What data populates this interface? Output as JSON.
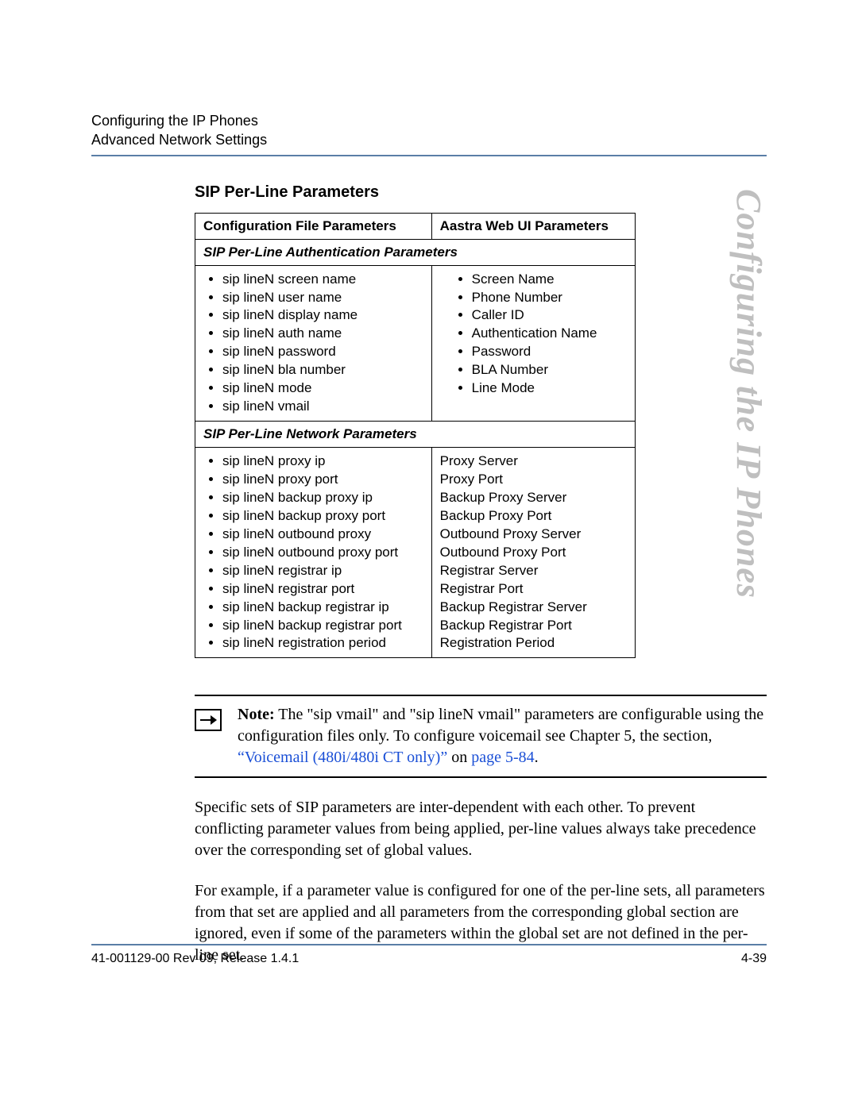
{
  "header": {
    "line1": "Configuring the IP Phones",
    "line2": "Advanced Network Settings"
  },
  "side_title": "Configuring the IP Phones",
  "section_title": "SIP Per-Line Parameters",
  "table": {
    "head_left": "Configuration File Parameters",
    "head_right": "Aastra Web UI Parameters",
    "sub1": "SIP Per-Line Authentication Parameters",
    "auth_cfg": [
      "sip lineN screen name",
      "sip lineN user name",
      "sip lineN display name",
      "sip lineN auth name",
      "sip lineN password",
      "sip lineN bla number",
      "sip lineN mode",
      "sip lineN vmail"
    ],
    "auth_web": [
      "Screen Name",
      "Phone Number",
      "Caller ID",
      "Authentication Name",
      "Password",
      "BLA Number",
      "Line Mode"
    ],
    "sub2": "SIP Per-Line Network Parameters",
    "net_cfg": [
      "sip lineN proxy ip",
      "sip lineN proxy port",
      "sip lineN backup proxy ip",
      "sip lineN backup proxy port",
      "sip lineN outbound proxy",
      "sip lineN outbound proxy port",
      "sip lineN registrar ip",
      "sip lineN registrar port",
      "sip lineN backup registrar ip",
      "sip lineN backup registrar port",
      "sip lineN registration period"
    ],
    "net_web": [
      "Proxy Server",
      "Proxy Port",
      "Backup Proxy Server",
      "Backup Proxy Port",
      "Outbound Proxy Server",
      "Outbound Proxy Port",
      "Registrar Server",
      "Registrar Port",
      "Backup Registrar Server",
      "Backup Registrar Port",
      "Registration Period"
    ]
  },
  "note": {
    "label": "Note:",
    "part1": " The \"sip vmail\" and \"sip lineN vmail\" parameters are configurable using the configuration files only. To configure voicemail see Chapter 5, the section, ",
    "link1": "“Voicemail (480i/480i CT only)”",
    "mid": " on ",
    "link2": "page 5-84",
    "end": "."
  },
  "para1": "Specific sets of SIP parameters are inter-dependent with each other. To prevent conflicting parameter values from being applied, per-line values always take precedence over the corresponding set of global values.",
  "para2": "For example, if a parameter value is configured for one of the per-line sets, all parameters from that set are applied and all parameters from the corresponding global section are ignored, even if some of the parameters within the global set are not defined in the per-line set.",
  "footer": {
    "left": "41-001129-00 Rev 09, Release 1.4.1",
    "right": "4-39"
  }
}
